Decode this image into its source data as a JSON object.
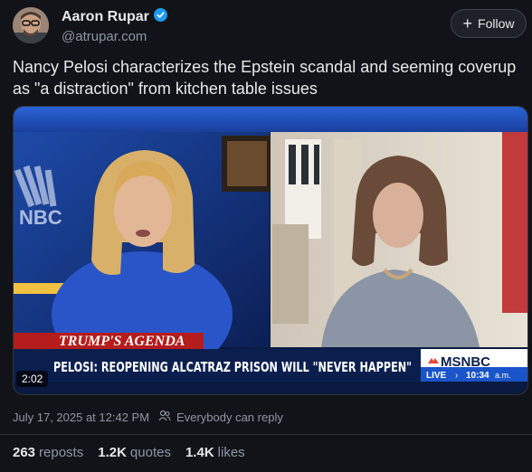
{
  "author": {
    "name": "Aaron Rupar",
    "handle": "@atrupar.com"
  },
  "follow_label": "Follow",
  "post_text": "Nancy Pelosi characterizes the Epstein scandal and seeming coverup as \"a distraction\" from kitchen table issues",
  "video": {
    "duration": "2:02",
    "lower_third_show": "TRUMP'S AGENDA",
    "headline": "PELOSI: REOPENING ALCATRAZ PRISON WILL \"NEVER HAPPEN\"",
    "network": "MSNBC",
    "live_label": "LIVE",
    "live_time": "10:34",
    "live_ampm": "a.m."
  },
  "timestamp": "July 17, 2025 at 12:42 PM",
  "reply_setting": "Everybody can reply",
  "stats": {
    "reposts_count": "263",
    "reposts_label": "reposts",
    "quotes_count": "1.2K",
    "quotes_label": "quotes",
    "likes_count": "1.4K",
    "likes_label": "likes"
  },
  "colors": {
    "background": "#121318",
    "verified": "#1d9bf0",
    "msnbc_blue": "#1a54c9"
  }
}
